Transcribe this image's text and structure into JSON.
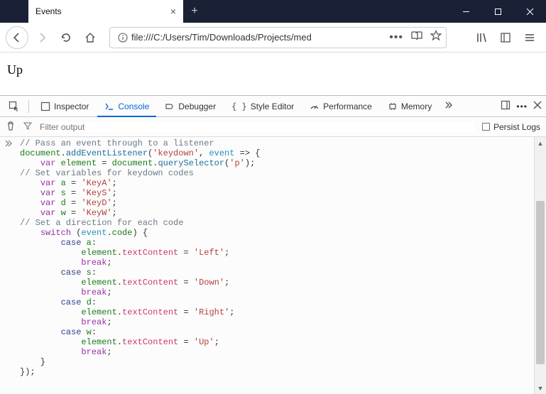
{
  "window": {
    "tab_title": "Events",
    "url_display": "file:///C:/Users/Tim/Downloads/Projects/med"
  },
  "page": {
    "heading": "Up"
  },
  "devtools": {
    "tabs": {
      "inspector": "Inspector",
      "console": "Console",
      "debugger": "Debugger",
      "style_editor": "Style Editor",
      "performance": "Performance",
      "memory": "Memory"
    },
    "filter_placeholder": "Filter output",
    "persist_label": "Persist Logs"
  },
  "code": {
    "comment1": "// Pass an event through to a listener",
    "l2_a": "document",
    "l2_b": "addEventListener",
    "l2_c": "'keydown'",
    "l2_d": "event",
    "l2_e": " => {",
    "l3_a": "var",
    "l3_b": "element",
    "l3_c": "document",
    "l3_d": "querySelector",
    "l3_e": "'p'",
    "comment2": "// Set variables for keydown codes",
    "l5_a": "var",
    "l5_b": "a",
    "l5_c": "'KeyA'",
    "l6_a": "var",
    "l6_b": "s",
    "l6_c": "'KeyS'",
    "l7_a": "var",
    "l7_b": "d",
    "l7_c": "'KeyD'",
    "l8_a": "var",
    "l8_b": "w",
    "l8_c": "'KeyW'",
    "comment3": "// Set a direction for each code",
    "l10_a": "switch",
    "l10_b": "event",
    "l10_c": "code",
    "l11_a": "case",
    "l11_b": "a",
    "l12_a": "element",
    "l12_b": "textContent",
    "l12_c": "'Left'",
    "l13_a": "break",
    "l14_a": "case",
    "l14_b": "s",
    "l15_a": "element",
    "l15_b": "textContent",
    "l15_c": "'Down'",
    "l16_a": "break",
    "l17_a": "case",
    "l17_b": "d",
    "l18_a": "element",
    "l18_b": "textContent",
    "l18_c": "'Right'",
    "l19_a": "break",
    "l20_a": "case",
    "l20_b": "w",
    "l21_a": "element",
    "l21_b": "textContent",
    "l21_c": "'Up'",
    "l22_a": "break",
    "l23": "    }",
    "l24": "});"
  }
}
